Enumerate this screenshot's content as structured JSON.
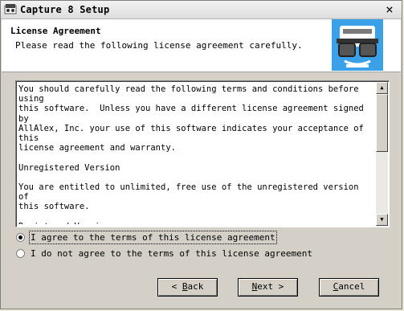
{
  "window": {
    "title": "Capture 8 Setup",
    "close_label": "×"
  },
  "header": {
    "title": "License Agreement",
    "subtitle": "Please read the following license agreement carefully."
  },
  "license": {
    "text": "You should carefully read the following terms and conditions before using\nthis software.  Unless you have a different license agreement signed by\nAllAlex, Inc. your use of this software indicates your acceptance of this\nlicense agreement and warranty.\n\nUnregistered Version\n\nYou are entitled to unlimited, free use of the unregistered version of\nthis software.\n\nRegistered Version\n\nOne registered copy of the software may be installed only on one computer\nat a time.  Your registration code is only to be entered into a single"
  },
  "options": [
    {
      "label": "I agree to the terms of this license agreement",
      "selected": true
    },
    {
      "label": "I do not agree to the terms of this license agreement",
      "selected": false
    }
  ],
  "buttons": {
    "back": {
      "prefix": "< ",
      "accel": "B",
      "rest": "ack"
    },
    "next": {
      "accel": "N",
      "rest": "ext >"
    },
    "cancel": {
      "accel": "C",
      "rest": "ancel"
    }
  },
  "icons": {
    "app": "capture-app-icon",
    "logo": "glasses-monitor-logo-icon"
  }
}
